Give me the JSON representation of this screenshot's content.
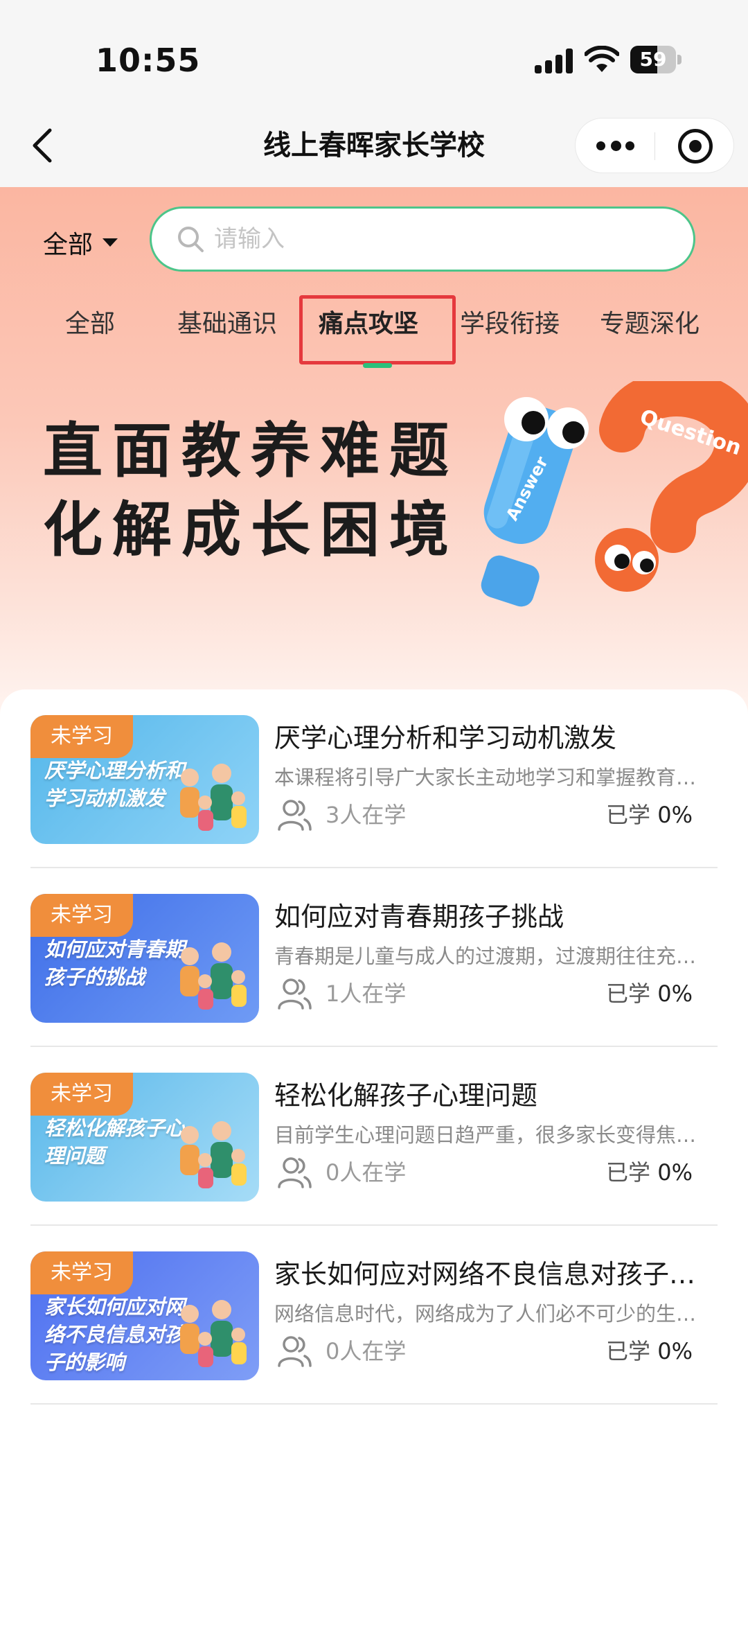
{
  "status_bar": {
    "time": "10:55",
    "battery": "59",
    "battery_level": 0.59
  },
  "nav": {
    "title": "线上春晖家长学校"
  },
  "filter": {
    "selected": "全部"
  },
  "search": {
    "placeholder": "请输入",
    "value": ""
  },
  "tabs": [
    {
      "label": "全部",
      "active": false
    },
    {
      "label": "基础通识",
      "active": false
    },
    {
      "label": "痛点攻坚",
      "active": true
    },
    {
      "label": "学段衔接",
      "active": false
    },
    {
      "label": "专题深化",
      "active": false
    }
  ],
  "banner": {
    "line1": "直面教养难题",
    "line2": "化解成长困境",
    "art_word_1": "Answer",
    "art_word_2": "Question"
  },
  "courses": [
    {
      "thumb_title": "厌学心理分析和学习动机激发",
      "badge": "未学习",
      "title": "厌学心理分析和学习动机激发",
      "description": "本课程将引导广大家长主动地学习和掌握教育孩子的方法",
      "learners": "3人在学",
      "progress_label": "已学",
      "progress_value": "0%",
      "thumb_color_a": "#55b7ea",
      "thumb_color_b": "#8fd3f7"
    },
    {
      "thumb_title": "如何应对青春期孩子的挑战",
      "badge": "未学习",
      "title": "如何应对青春期孩子挑战",
      "description": "青春期是儿童与成人的过渡期，过渡期往往充满挑战",
      "learners": "1人在学",
      "progress_label": "已学",
      "progress_value": "0%",
      "thumb_color_a": "#3f6ee8",
      "thumb_color_b": "#6f9bf5"
    },
    {
      "thumb_title": "轻松化解孩子心理问题",
      "badge": "未学习",
      "title": "轻松化解孩子心理问题",
      "description": "目前学生心理问题日趋严重，很多家长变得焦虑不安",
      "learners": "0人在学",
      "progress_label": "已学",
      "progress_value": "0%",
      "thumb_color_a": "#5ab8ea",
      "thumb_color_b": "#a6dcf7"
    },
    {
      "thumb_title": "家长如何应对网络不良信息对孩子的影响",
      "badge": "未学习",
      "title": "家长如何应对网络不良信息对孩子的影响",
      "description": "网络信息时代，网络成为了人们必不可少的生活工具",
      "learners": "0人在学",
      "progress_label": "已学",
      "progress_value": "0%",
      "thumb_color_a": "#4d6ff0",
      "thumb_color_b": "#7f9ef6"
    }
  ]
}
